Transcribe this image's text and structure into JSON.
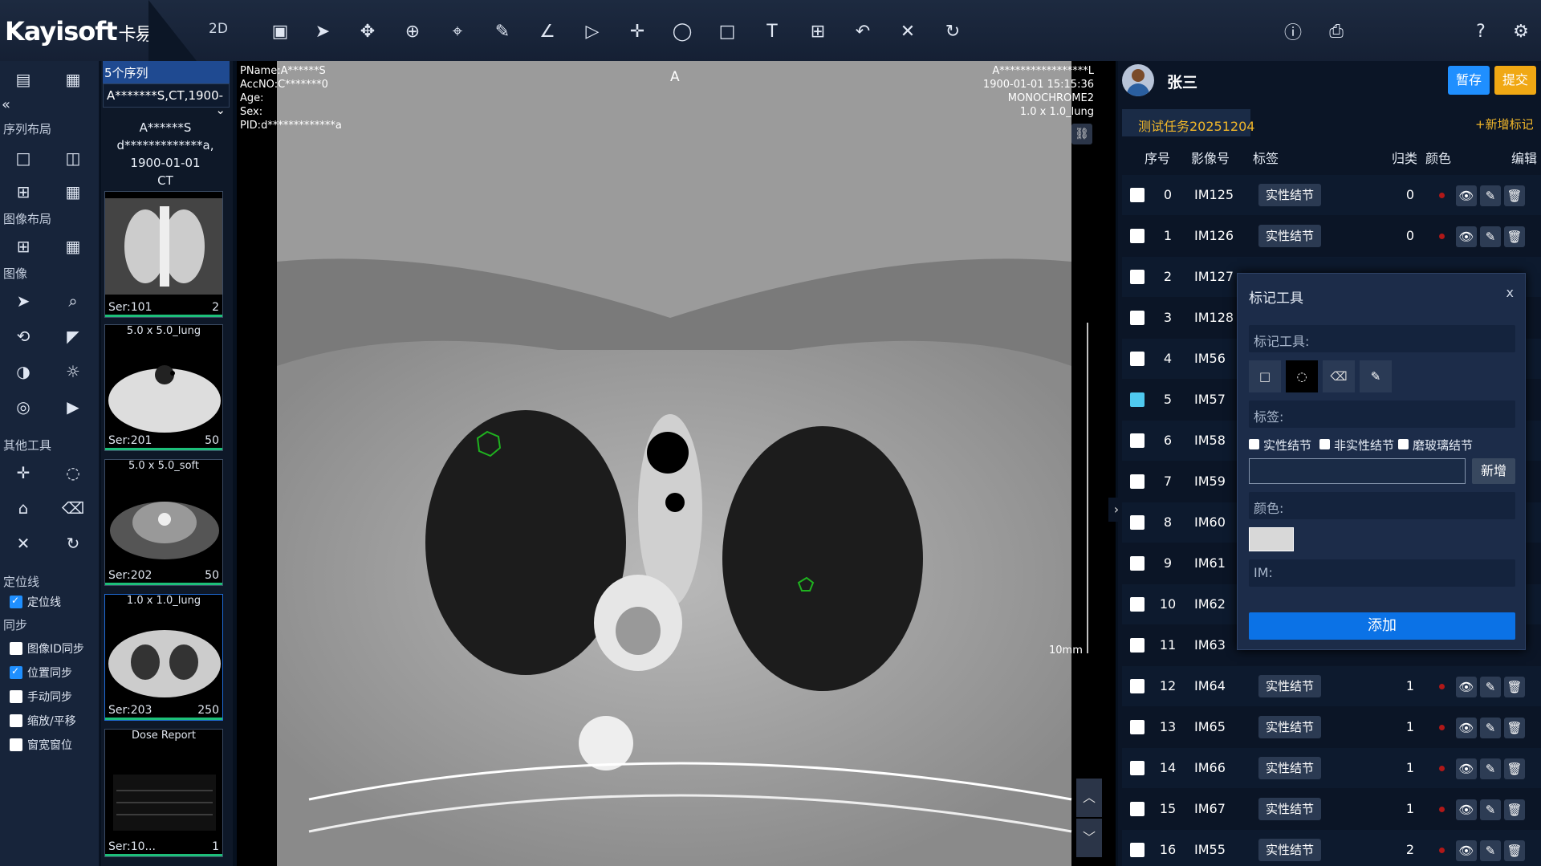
{
  "topbar": {
    "logo": "Kayisoft",
    "logo_cn": "卡易",
    "mode": "2D",
    "tools": [
      "layout-icon",
      "pointer-icon",
      "pan-icon",
      "zoom-icon",
      "crosshair-icon",
      "ruler-icon",
      "angle-icon",
      "play-icon",
      "plus-icon",
      "ellipse-icon",
      "rect-icon",
      "text-icon",
      "measure-icon",
      "undo-icon",
      "x-icon",
      "reset-icon"
    ],
    "right_tools": [
      "info-icon",
      "save-icon",
      "help-icon",
      "gear-icon"
    ]
  },
  "leftnav": {
    "sections": {
      "seq_layout": "序列布局",
      "img_layout": "图像布局",
      "image": "图像",
      "other": "其他工具",
      "locator": "定位线",
      "sync": "同步"
    },
    "locator_label": "定位线",
    "sync": [
      {
        "label": "图像ID同步",
        "checked": false
      },
      {
        "label": "位置同步",
        "checked": true
      },
      {
        "label": "手动同步",
        "checked": false
      },
      {
        "label": "缩放/平移",
        "checked": false
      },
      {
        "label": "窗宽窗位",
        "checked": false
      }
    ]
  },
  "series": {
    "count_label": "5个序列",
    "select": "A*******S,CT,1900-",
    "patient": [
      "A******S",
      "d*************a,",
      "1900-01-01",
      "CT"
    ],
    "thumbs": [
      {
        "cap": "",
        "ser": "Ser:101",
        "cnt": "2"
      },
      {
        "cap": "5.0 x 5.0_lung",
        "ser": "Ser:201",
        "cnt": "50"
      },
      {
        "cap": "5.0 x 5.0_soft",
        "ser": "Ser:202",
        "cnt": "50"
      },
      {
        "cap": "1.0 x 1.0_lung",
        "ser": "Ser:203",
        "cnt": "250"
      },
      {
        "cap": "Dose Report",
        "ser": "Ser:10...",
        "cnt": "1"
      }
    ]
  },
  "viewer": {
    "tl": [
      "PName:A******S",
      "AccNO:C*******0",
      "Age:",
      "Sex:",
      "PID:d*************a"
    ],
    "tr": [
      "A*****************L",
      "1900-01-01 15:15:36",
      "MONOCHROME2",
      "1.0 x 1.0_lung"
    ],
    "orient": "A",
    "scale": "10mm"
  },
  "right": {
    "user": "张三",
    "save": "暂存",
    "submit": "提交",
    "task": "测试任务20251204",
    "add_mark": "+新增标记",
    "headers": {
      "seq": "序号",
      "im": "影像号",
      "tag": "标签",
      "cls": "归类",
      "color": "颜色",
      "edit": "编辑"
    },
    "rows": [
      {
        "i": "0",
        "im": "IM125",
        "tag": "实性结节",
        "c": "0"
      },
      {
        "i": "1",
        "im": "IM126",
        "tag": "实性结节",
        "c": "0"
      },
      {
        "i": "2",
        "im": "IM127",
        "tag": "",
        "c": ""
      },
      {
        "i": "3",
        "im": "IM128",
        "tag": "",
        "c": ""
      },
      {
        "i": "4",
        "im": "IM56",
        "tag": "",
        "c": ""
      },
      {
        "i": "5",
        "im": "IM57",
        "tag": "",
        "c": ""
      },
      {
        "i": "6",
        "im": "IM58",
        "tag": "",
        "c": ""
      },
      {
        "i": "7",
        "im": "IM59",
        "tag": "",
        "c": ""
      },
      {
        "i": "8",
        "im": "IM60",
        "tag": "",
        "c": ""
      },
      {
        "i": "9",
        "im": "IM61",
        "tag": "",
        "c": ""
      },
      {
        "i": "10",
        "im": "IM62",
        "tag": "",
        "c": ""
      },
      {
        "i": "11",
        "im": "IM63",
        "tag": "",
        "c": ""
      },
      {
        "i": "12",
        "im": "IM64",
        "tag": "实性结节",
        "c": "1"
      },
      {
        "i": "13",
        "im": "IM65",
        "tag": "实性结节",
        "c": "1"
      },
      {
        "i": "14",
        "im": "IM66",
        "tag": "实性结节",
        "c": "1"
      },
      {
        "i": "15",
        "im": "IM67",
        "tag": "实性结节",
        "c": "1"
      },
      {
        "i": "16",
        "im": "IM55",
        "tag": "实性结节",
        "c": "2"
      }
    ]
  },
  "popup": {
    "title": "标记工具",
    "close": "x",
    "tool_label": "标记工具:",
    "tag_label": "标签:",
    "options": [
      "实性结节",
      "非实性结节",
      "磨玻璃结节"
    ],
    "new_btn": "新增",
    "color_label": "颜色:",
    "im_label": "IM:",
    "add_btn": "添加",
    "input_value": ""
  }
}
